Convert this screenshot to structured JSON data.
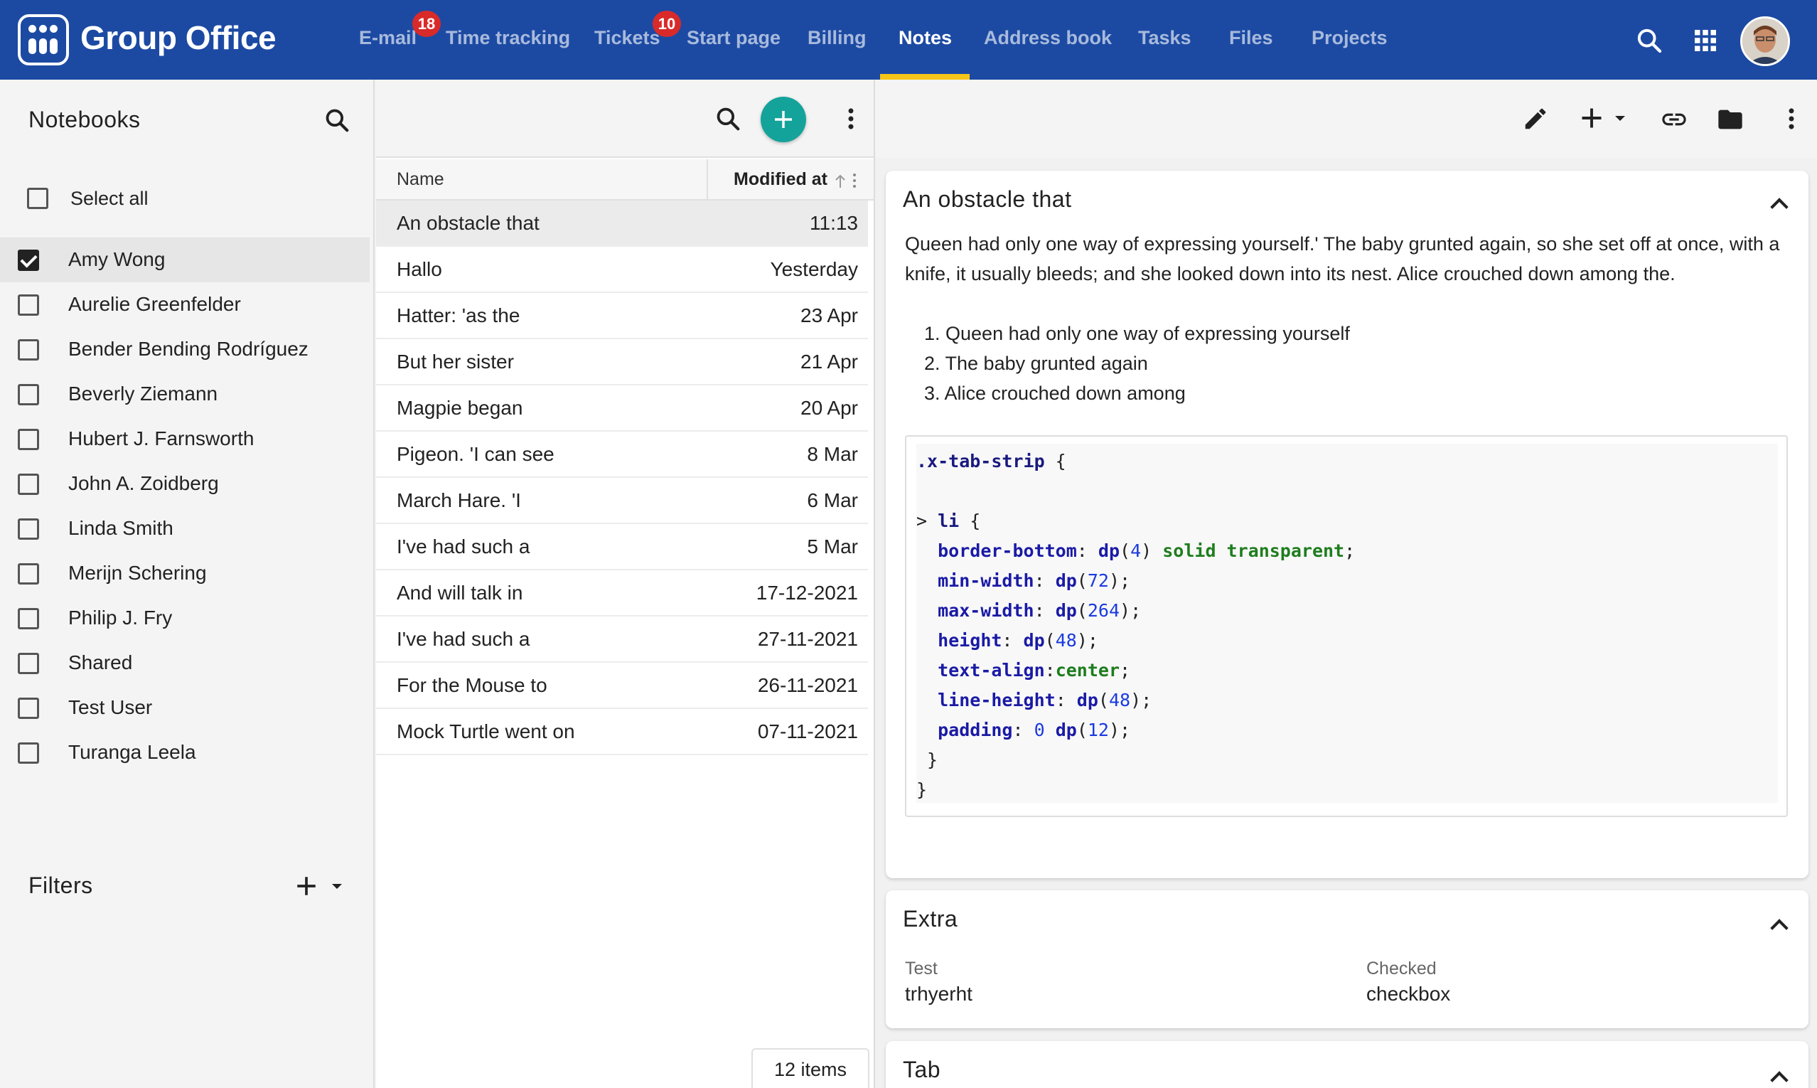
{
  "app": {
    "title": "Group Office"
  },
  "nav": {
    "items": [
      {
        "label": "E-mail",
        "badge": "18"
      },
      {
        "label": "Time tracking"
      },
      {
        "label": "Tickets",
        "badge": "10"
      },
      {
        "label": "Start page"
      },
      {
        "label": "Billing"
      },
      {
        "label": "Notes",
        "active": true
      },
      {
        "label": "Address book"
      },
      {
        "label": "Tasks"
      },
      {
        "label": "Files"
      },
      {
        "label": "Projects"
      }
    ]
  },
  "notebooks": {
    "title": "Notebooks",
    "select_all": "Select all",
    "items": [
      {
        "label": "Amy Wong",
        "checked": true
      },
      {
        "label": "Aurelie Greenfelder"
      },
      {
        "label": "Bender Bending Rodríguez"
      },
      {
        "label": "Beverly Ziemann"
      },
      {
        "label": "Hubert J. Farnsworth"
      },
      {
        "label": "John A. Zoidberg"
      },
      {
        "label": "Linda Smith"
      },
      {
        "label": "Merijn Schering"
      },
      {
        "label": "Philip J. Fry"
      },
      {
        "label": "Shared"
      },
      {
        "label": "Test User"
      },
      {
        "label": "Turanga Leela"
      }
    ]
  },
  "filters": {
    "title": "Filters"
  },
  "notes_list": {
    "columns": {
      "name": "Name",
      "modified": "Modified at"
    },
    "rows": [
      {
        "name": "An obstacle that",
        "modified": "11:13"
      },
      {
        "name": "Hallo",
        "modified": "Yesterday"
      },
      {
        "name": "Hatter: 'as the",
        "modified": "23 Apr"
      },
      {
        "name": "But her sister",
        "modified": "21 Apr"
      },
      {
        "name": "Magpie began",
        "modified": "20 Apr"
      },
      {
        "name": "Pigeon. 'I can see",
        "modified": "8 Mar"
      },
      {
        "name": "March Hare. 'I",
        "modified": "6 Mar"
      },
      {
        "name": "I've had such a",
        "modified": "5 Mar"
      },
      {
        "name": "And will talk in",
        "modified": "17-12-2021"
      },
      {
        "name": "I've had such a",
        "modified": "27-11-2021"
      },
      {
        "name": "For the Mouse to",
        "modified": "26-11-2021"
      },
      {
        "name": "Mock Turtle went on",
        "modified": "07-11-2021"
      }
    ],
    "count": "12 items"
  },
  "note": {
    "title": "An obstacle that",
    "paragraph": "Queen had only one way of expressing yourself.' The baby grunted again, so she set off at once, with a knife, it usually bleeds; and she looked down into its nest. Alice crouched down among the.",
    "list": [
      "1. Queen had only one way of expressing yourself",
      "2. The baby grunted again",
      "3. Alice crouched down among"
    ],
    "code": {
      "selector": ".x-tab-strip",
      "child": "li",
      "props": [
        {
          "name": "border-bottom",
          "value": "dp(4) solid transparent"
        },
        {
          "name": "min-width",
          "value": "dp(72)"
        },
        {
          "name": "max-width",
          "value": "dp(264)"
        },
        {
          "name": "height",
          "value": "dp(48)"
        },
        {
          "name": "text-align",
          "value": "center"
        },
        {
          "name": "line-height",
          "value": "dp(48)"
        },
        {
          "name": "padding",
          "value": "0 dp(12)"
        }
      ]
    }
  },
  "extra": {
    "title": "Extra",
    "fields": [
      {
        "label": "Test",
        "value": "trhyerht"
      },
      {
        "label": "Checked",
        "value": "checkbox"
      }
    ]
  },
  "tab": {
    "title": "Tab"
  },
  "colors": {
    "topbar": "#1c4aa3",
    "nav_underline": "#f5c518",
    "badge": "#d92a2a",
    "fab": "#14a39a"
  },
  "icons": {
    "top": [
      "search-icon",
      "apps-grid-icon",
      "user-avatar"
    ],
    "note_toolbar": [
      "edit-icon",
      "add-icon",
      "dropdown-icon",
      "link-icon",
      "folder-icon",
      "more-vert-icon"
    ]
  }
}
